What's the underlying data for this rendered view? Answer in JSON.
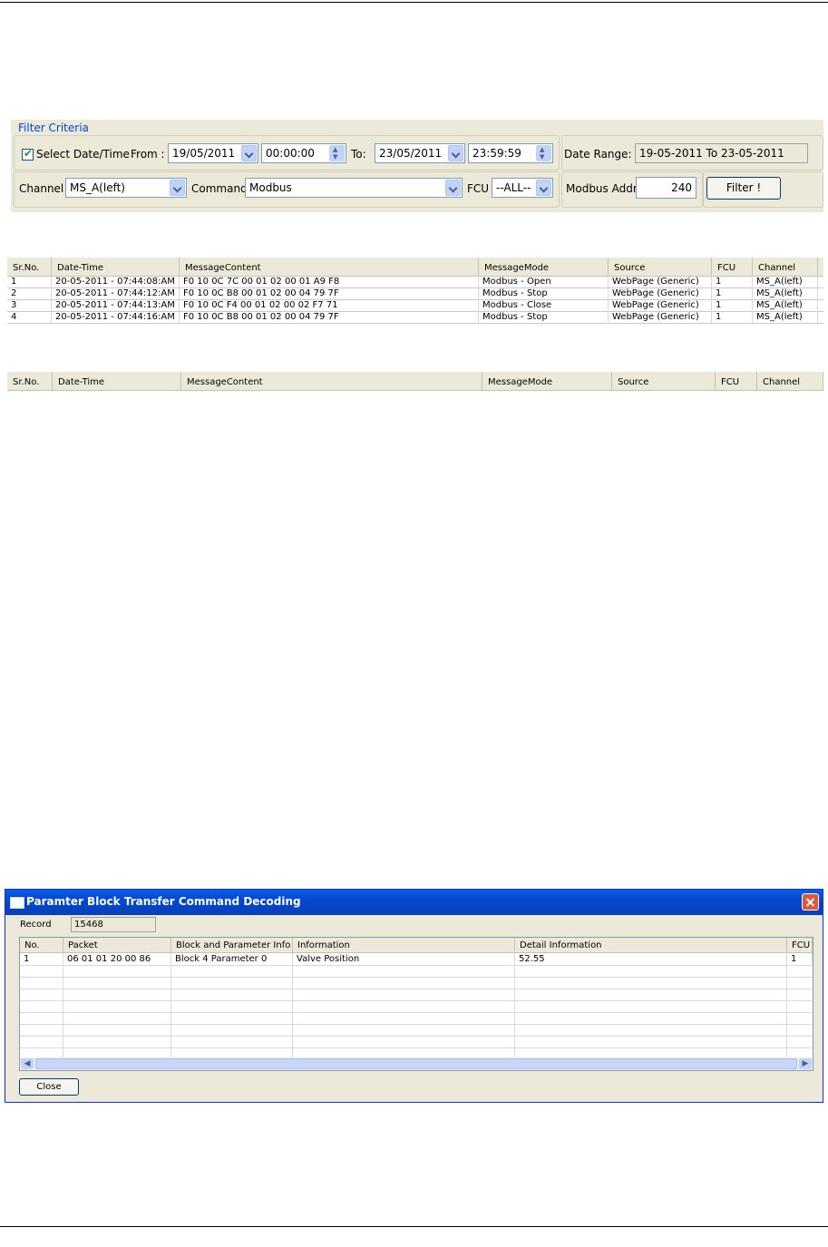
{
  "filter": {
    "legend": "Filter Criteria",
    "select_datetime_label": "Select Date/Time",
    "select_datetime_checked": true,
    "from_label": "From :",
    "from_date": "19/05/2011",
    "from_time": "00:00:00",
    "to_label": "To:",
    "to_date": "23/05/2011",
    "to_time": "23:59:59",
    "date_range_label": "Date Range:",
    "date_range_value": "19-05-2011  To  23-05-2011",
    "channel_label": "Channel",
    "channel_value": "MS_A(left)",
    "command_label": "Command",
    "command_value": "Modbus",
    "fcu_label": "FCU",
    "fcu_value": "--ALL--",
    "modbus_addr_label": "Modbus Addr:",
    "modbus_addr_value": "240",
    "filter_button": "Filter !"
  },
  "messages": {
    "columns": [
      "Sr.No.",
      "Date-Time",
      "MessageContent",
      "MessageMode",
      "Source",
      "FCU",
      "Channel"
    ],
    "rows": [
      [
        "1",
        "20-05-2011 - 07:44:08:AM",
        "F0 10 0C 7C 00 01 02 00 01 A9 F8",
        "Modbus - Open",
        "WebPage (Generic)",
        "1",
        "MS_A(left)"
      ],
      [
        "2",
        "20-05-2011 - 07:44:12:AM",
        "F0 10 0C B8 00 01 02 00 04 79 7F",
        "Modbus - Stop",
        "WebPage (Generic)",
        "1",
        "MS_A(left)"
      ],
      [
        "3",
        "20-05-2011 - 07:44:13:AM",
        "F0 10 0C F4 00 01 02 00 02 F7 71",
        "Modbus - Close",
        "WebPage (Generic)",
        "1",
        "MS_A(left)"
      ],
      [
        "4",
        "20-05-2011 - 07:44:16:AM",
        "F0 10 0C B8 00 01 02 00 04 79 7F",
        "Modbus - Stop",
        "WebPage (Generic)",
        "1",
        "MS_A(left)"
      ]
    ]
  },
  "empty_grid": {
    "columns": [
      "Sr.No.",
      "Date-Time",
      "MessageContent",
      "MessageMode",
      "Source",
      "FCU",
      "Channel"
    ]
  },
  "dialog": {
    "title": "Paramter Block Transfer Command Decoding",
    "record_label": "Record",
    "record_value": "15468",
    "columns": [
      "No.",
      "Packet",
      "Block and Parameter Info",
      "Information",
      "Detail Information",
      "FCU"
    ],
    "rows": [
      [
        "1",
        "06 01 01 20 00 86",
        "Block 4 Parameter 0",
        "Valve Position",
        "52.55",
        "1"
      ]
    ],
    "close_button": "Close"
  }
}
